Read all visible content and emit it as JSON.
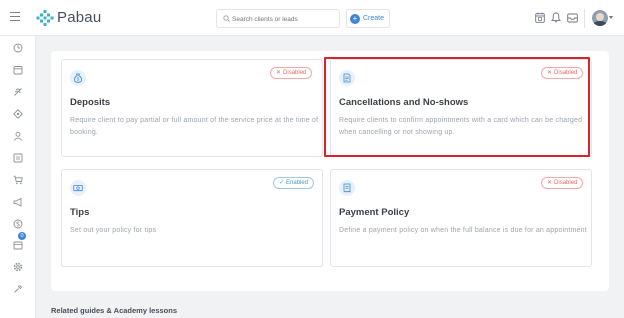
{
  "app": {
    "brand": "Pabau",
    "accent": "#3e85d6",
    "highlight_color": "#d8232a"
  },
  "header": {
    "search_placeholder": "Search clients or leads",
    "create_label": "Create",
    "icons": [
      "calendar-icon",
      "bell-icon",
      "inbox-icon"
    ]
  },
  "sidebar": {
    "icons": [
      "menu-icon",
      "dashboard-icon",
      "calendar-icon",
      "leads-icon",
      "marketing-icon",
      "clients-icon",
      "reports-icon",
      "shop-icon",
      "campaigns-icon",
      "finance-icon",
      "inventory-icon",
      "settings-icon",
      "setup-icon"
    ],
    "badge": "0"
  },
  "cards": [
    {
      "title": "Deposits",
      "description": "Require client to pay partial or full amount of the service price at the time of booking.",
      "status": "Disabled",
      "status_glyph": "✕",
      "icon": "money-bag-icon"
    },
    {
      "title": "Cancellations and No-shows",
      "description": "Require clients to confirm appointments with a card which can be charged when cancelling or not showing up.",
      "status": "Disabled",
      "status_glyph": "✕",
      "icon": "document-icon"
    },
    {
      "title": "Tips",
      "description": "Set out your policy for tips",
      "status": "Enabled",
      "status_glyph": "✓",
      "icon": "banknote-icon"
    },
    {
      "title": "Payment Policy",
      "description": "Define a payment policy on when the full balance is due for an appointment",
      "status": "Disabled",
      "status_glyph": "✕",
      "icon": "receipt-icon"
    }
  ],
  "footer": {
    "title": "Related guides & Academy lessons"
  }
}
